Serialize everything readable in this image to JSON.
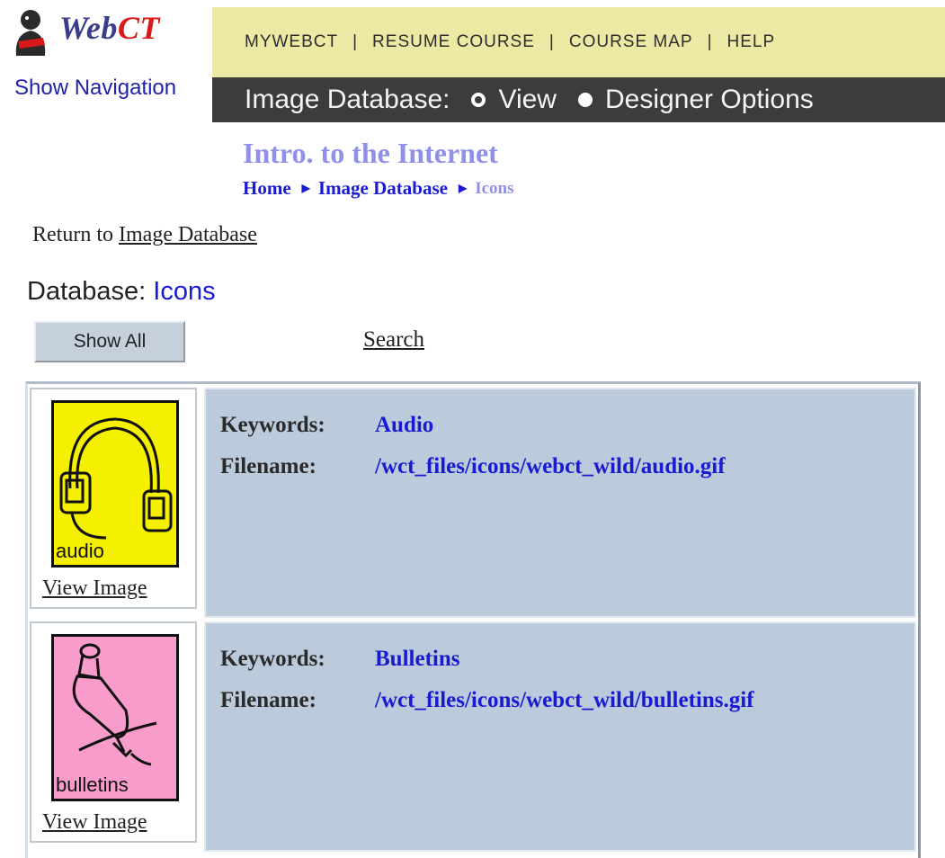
{
  "brand": {
    "name_prefix": "Web",
    "name_suffix": "CT"
  },
  "show_navigation": "Show Navigation",
  "topnav": {
    "items": [
      "MYWEBCT",
      "RESUME COURSE",
      "COURSE MAP",
      "HELP"
    ],
    "separator": "|"
  },
  "tool_bar": {
    "label": "Image Database:",
    "options": [
      {
        "label": "View",
        "selected": true
      },
      {
        "label": "Designer Options",
        "selected": false
      }
    ]
  },
  "course": {
    "title": "Intro. to the Internet"
  },
  "breadcrumb": {
    "items": [
      "Home",
      "Image Database"
    ],
    "current": "Icons"
  },
  "return_nav": {
    "prefix": "Return to",
    "link": "Image Database"
  },
  "database": {
    "label": "Database:",
    "name": "Icons"
  },
  "actions": {
    "show_all": "Show All",
    "search": "Search"
  },
  "labels": {
    "keywords": "Keywords:",
    "filename": "Filename:",
    "view_image": "View Image"
  },
  "entries": [
    {
      "keywords": "Audio",
      "filename": "/wct_files/icons/webct_wild/audio.gif",
      "thumb_label": "audio",
      "thumb_icon": "headphones-icon",
      "thumb_color": "#f5ef00"
    },
    {
      "keywords": "Bulletins",
      "filename": "/wct_files/icons/webct_wild/bulletins.gif",
      "thumb_label": "bulletins",
      "thumb_icon": "pushpin-icon",
      "thumb_color": "#f79ccb"
    }
  ],
  "colors": {
    "topbar_bg": "#ece9a4",
    "toolbar_bg": "#3c3c3c",
    "link_blue": "#1a1ad0",
    "course_title": "#9090e8",
    "info_bg": "#bccbdc"
  }
}
